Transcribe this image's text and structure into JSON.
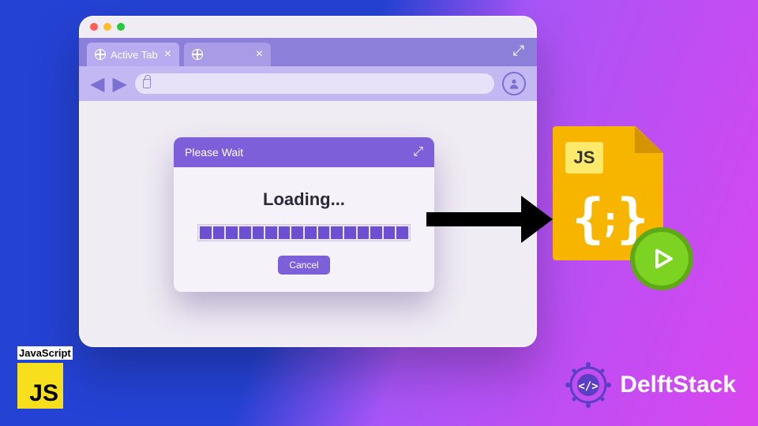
{
  "browser": {
    "traffic_lights": [
      "#ff5f57",
      "#febc2e",
      "#28c840"
    ],
    "tabs": [
      {
        "label": "Active Tab",
        "active": true
      },
      {
        "label": "",
        "active": false
      }
    ],
    "address_value": ""
  },
  "dialog": {
    "title": "Please Wait",
    "loading_label": "Loading...",
    "cancel_label": "Cancel",
    "progress_segments": 16
  },
  "jsfile": {
    "badge": "JS",
    "code": "{;}"
  },
  "js_logo": {
    "label": "JavaScript",
    "box": "JS"
  },
  "brand": {
    "name": "DelftStack"
  }
}
